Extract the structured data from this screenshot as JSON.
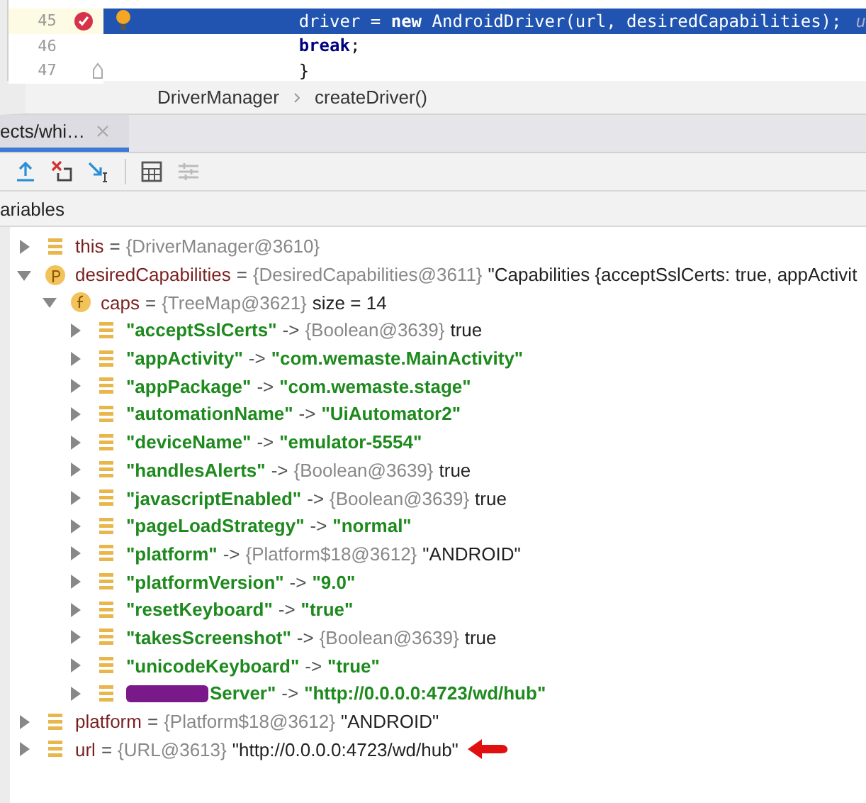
{
  "editor": {
    "lines": [
      {
        "number": "45",
        "code": "driver = **new** AndroidDriver(url, desiredCapabilities);",
        "hint": "u",
        "current": true,
        "breakpoint": true,
        "intention": true,
        "fold": false
      },
      {
        "number": "46",
        "code": "**break**;",
        "current": false,
        "breakpoint": false,
        "intention": false,
        "fold": false
      },
      {
        "number": "47",
        "code": "}",
        "current": false,
        "breakpoint": false,
        "intention": false,
        "fold": true
      }
    ]
  },
  "breadcrumb": [
    "DriverManager",
    "createDriver()"
  ],
  "debug_tab": {
    "label": "ects/whi…",
    "selected": true
  },
  "variables_header": "ariables",
  "variables": [
    {
      "kind": "field",
      "operator": "=",
      "name": "this",
      "ref": "{DriverManager@3610}",
      "expanded": false
    },
    {
      "kind": "parameter",
      "operator": "=",
      "name": "desiredCapabilities",
      "ref": "{DesiredCapabilities@3611}",
      "value": "\"Capabilities {acceptSslCerts: true, appActivit",
      "expanded": true,
      "children": [
        {
          "kind": "final-field",
          "operator": "=",
          "name": "caps",
          "ref": "{TreeMap@3621}",
          "value": "size = 14",
          "expanded": true,
          "children": [
            {
              "kind": "entry",
              "operator": "->",
              "name": "\"acceptSslCerts\"",
              "ref": "{Boolean@3639}",
              "value": "true",
              "expanded": false
            },
            {
              "kind": "entry",
              "operator": "->",
              "name": "\"appActivity\"",
              "value": "\"com.wemaste.MainActivity\"",
              "expanded": false
            },
            {
              "kind": "entry",
              "operator": "->",
              "name": "\"appPackage\"",
              "value": "\"com.wemaste.stage\"",
              "expanded": false
            },
            {
              "kind": "entry",
              "operator": "->",
              "name": "\"automationName\"",
              "value": "\"UiAutomator2\"",
              "expanded": false
            },
            {
              "kind": "entry",
              "operator": "->",
              "name": "\"deviceName\"",
              "value": "\"emulator-5554\"",
              "expanded": false
            },
            {
              "kind": "entry",
              "operator": "->",
              "name": "\"handlesAlerts\"",
              "ref": "{Boolean@3639}",
              "value": "true",
              "expanded": false
            },
            {
              "kind": "entry",
              "operator": "->",
              "name": "\"javascriptEnabled\"",
              "ref": "{Boolean@3639}",
              "value": "true",
              "expanded": false
            },
            {
              "kind": "entry",
              "operator": "->",
              "name": "\"pageLoadStrategy\"",
              "value": "\"normal\"",
              "expanded": false
            },
            {
              "kind": "entry",
              "operator": "->",
              "name": "\"platform\"",
              "ref": "{Platform$18@3612}",
              "value": "\"ANDROID\"",
              "expanded": false
            },
            {
              "kind": "entry",
              "operator": "->",
              "name": "\"platformVersion\"",
              "value": "\"9.0\"",
              "expanded": false
            },
            {
              "kind": "entry",
              "operator": "->",
              "name": "\"resetKeyboard\"",
              "value": "\"true\"",
              "expanded": false
            },
            {
              "kind": "entry",
              "operator": "->",
              "name": "\"takesScreenshot\"",
              "ref": "{Boolean@3639}",
              "value": "true",
              "expanded": false
            },
            {
              "kind": "entry",
              "operator": "->",
              "name": "\"unicodeKeyboard\"",
              "value": "\"true\"",
              "expanded": false
            },
            {
              "kind": "entry",
              "operator": "->",
              "name": "Server\"",
              "redacted": true,
              "value": "\"http://0.0.0.0:4723/wd/hub\"",
              "expanded": false
            }
          ]
        }
      ]
    },
    {
      "kind": "field",
      "operator": "=",
      "name": "platform",
      "ref": "{Platform$18@3612}",
      "value": "\"ANDROID\"",
      "expanded": false
    },
    {
      "kind": "field",
      "operator": "=",
      "name": "url",
      "ref": "{URL@3613}",
      "value": "\"http://0.0.0.0:4723/wd/hub\"",
      "expanded": false,
      "pointer": true
    }
  ]
}
